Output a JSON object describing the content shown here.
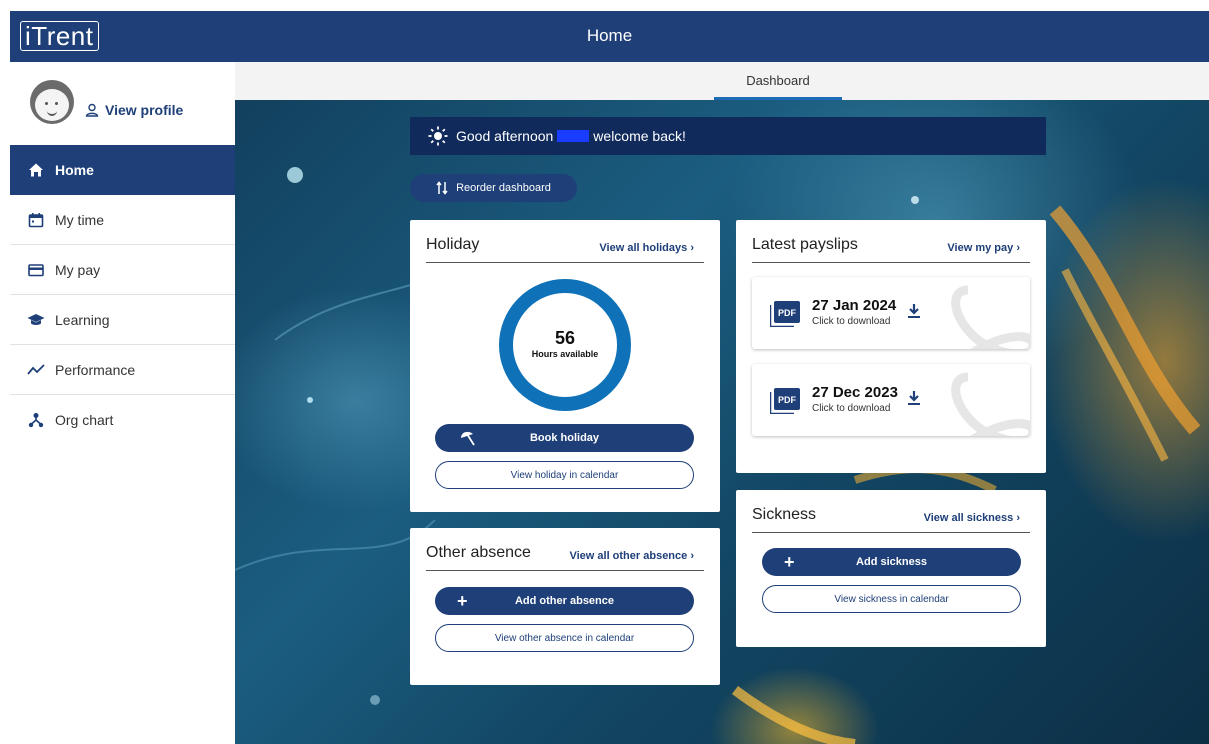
{
  "header": {
    "logo": "iTrent",
    "title": "Home"
  },
  "sidebar": {
    "profile_label": "View profile",
    "items": [
      {
        "label": "Home",
        "icon": "home-icon",
        "active": true
      },
      {
        "label": "My time",
        "icon": "calendar-icon"
      },
      {
        "label": "My pay",
        "icon": "card-icon"
      },
      {
        "label": "Learning",
        "icon": "graduation-cap-icon"
      },
      {
        "label": "Performance",
        "icon": "trend-icon"
      },
      {
        "label": "Org chart",
        "icon": "org-chart-icon"
      }
    ]
  },
  "tabs": [
    {
      "label": "Dashboard",
      "active": true
    }
  ],
  "greeting": {
    "prefix": "Good afternoon",
    "suffix": "welcome back!"
  },
  "reorder_label": "Reorder dashboard",
  "holiday": {
    "title": "Holiday",
    "link": "View all holidays",
    "hours": "56",
    "hours_label": "Hours available",
    "book_label": "Book holiday",
    "calendar_label": "View holiday in calendar"
  },
  "payslips": {
    "title": "Latest payslips",
    "link": "View my pay",
    "items": [
      {
        "date": "27 Jan 2024",
        "sub": "Click to download"
      },
      {
        "date": "27 Dec 2023",
        "sub": "Click to download"
      }
    ]
  },
  "other_absence": {
    "title": "Other absence",
    "link": "View all other absence",
    "add_label": "Add other absence",
    "calendar_label": "View other absence in calendar"
  },
  "sickness": {
    "title": "Sickness",
    "link": "View all sickness",
    "add_label": "Add sickness",
    "calendar_label": "View sickness in calendar"
  },
  "colors": {
    "primary": "#1e3f78",
    "accent": "#1e6bb8",
    "donut": "#0f72b8"
  }
}
